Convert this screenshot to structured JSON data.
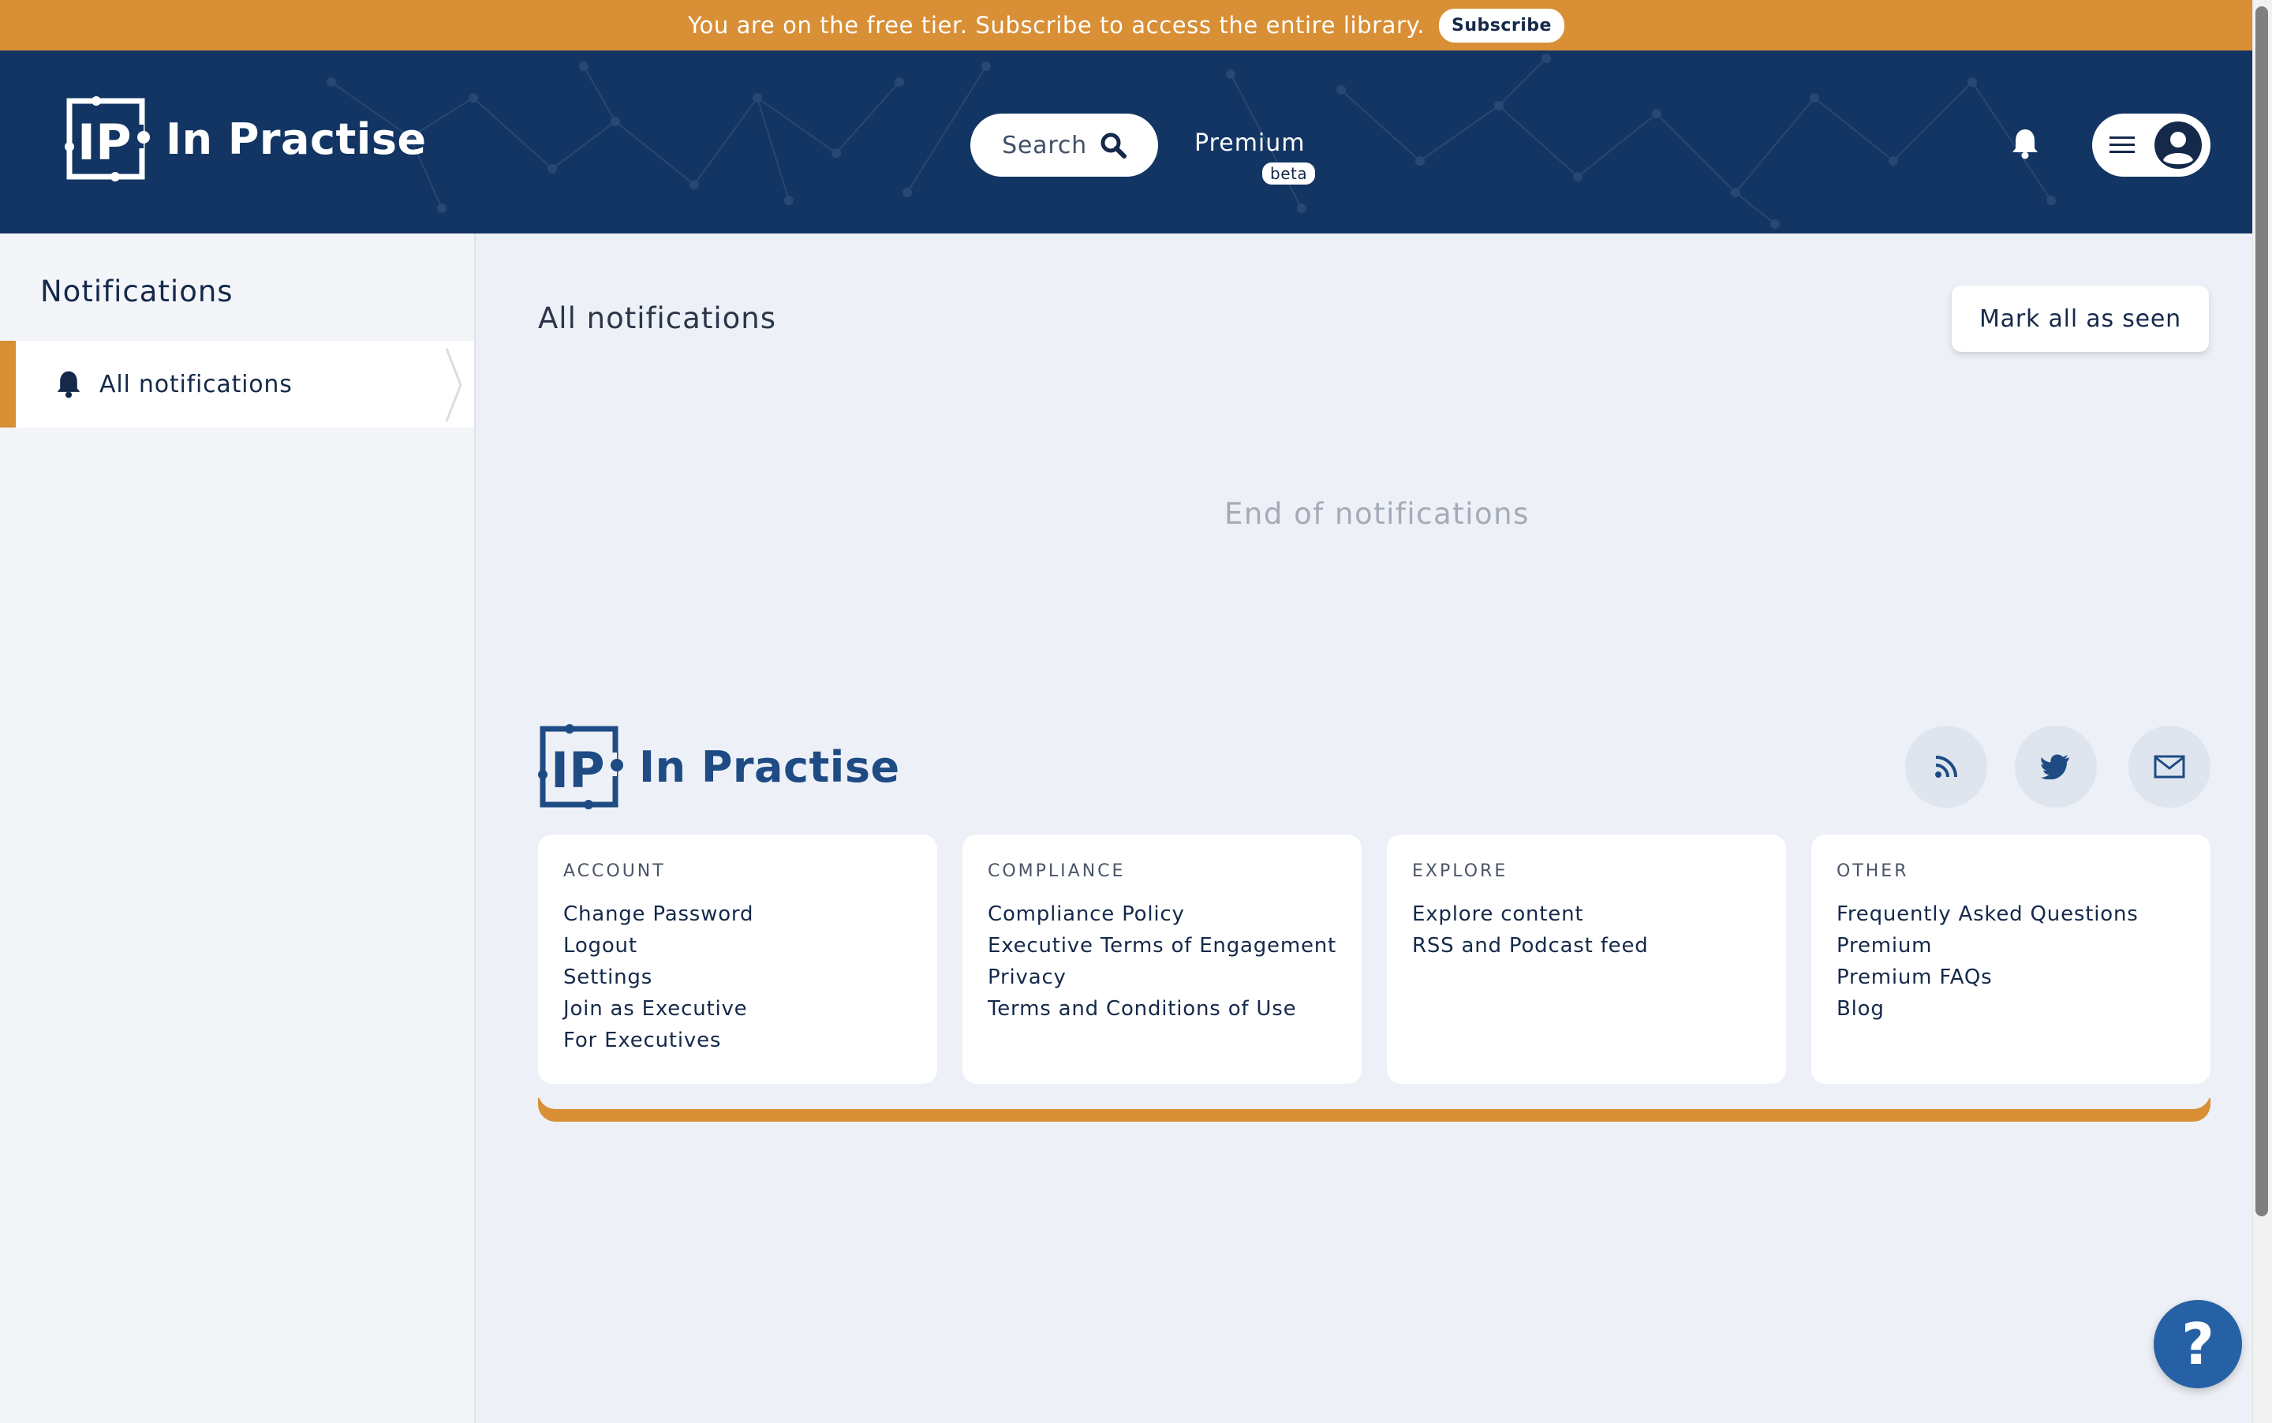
{
  "banner": {
    "text": "You are on the free tier. Subscribe to access the entire library.",
    "subscribe_label": "Subscribe"
  },
  "header": {
    "logo_text": "In Practise",
    "search_label": "Search",
    "premium_label": "Premium",
    "beta_label": "beta"
  },
  "sidebar": {
    "title": "Notifications",
    "items": [
      {
        "label": "All notifications",
        "icon": "bell-icon",
        "active": true
      }
    ]
  },
  "main": {
    "title": "All notifications",
    "mark_all_label": "Mark all as seen",
    "end_text": "End of notifications"
  },
  "footer": {
    "logo_text": "In Practise",
    "social": [
      "rss-icon",
      "twitter-icon",
      "mail-icon"
    ],
    "columns": [
      {
        "heading": "ACCOUNT",
        "links": [
          "Change Password",
          "Logout",
          "Settings",
          "Join as Executive",
          "For Executives"
        ]
      },
      {
        "heading": "COMPLIANCE",
        "links": [
          "Compliance Policy",
          "Executive Terms of Engagement",
          "Privacy",
          "Terms and Conditions of Use"
        ]
      },
      {
        "heading": "EXPLORE",
        "links": [
          "Explore content",
          "RSS and Podcast feed"
        ]
      },
      {
        "heading": "OTHER",
        "links": [
          "Frequently Asked Questions",
          "Premium",
          "Premium FAQs",
          "Blog"
        ]
      }
    ]
  },
  "help": {
    "label": "?"
  },
  "colors": {
    "brand_navy": "#123563",
    "accent_orange": "#d88f35",
    "footer_blue": "#1e4b84",
    "background": "#edf0f6"
  }
}
